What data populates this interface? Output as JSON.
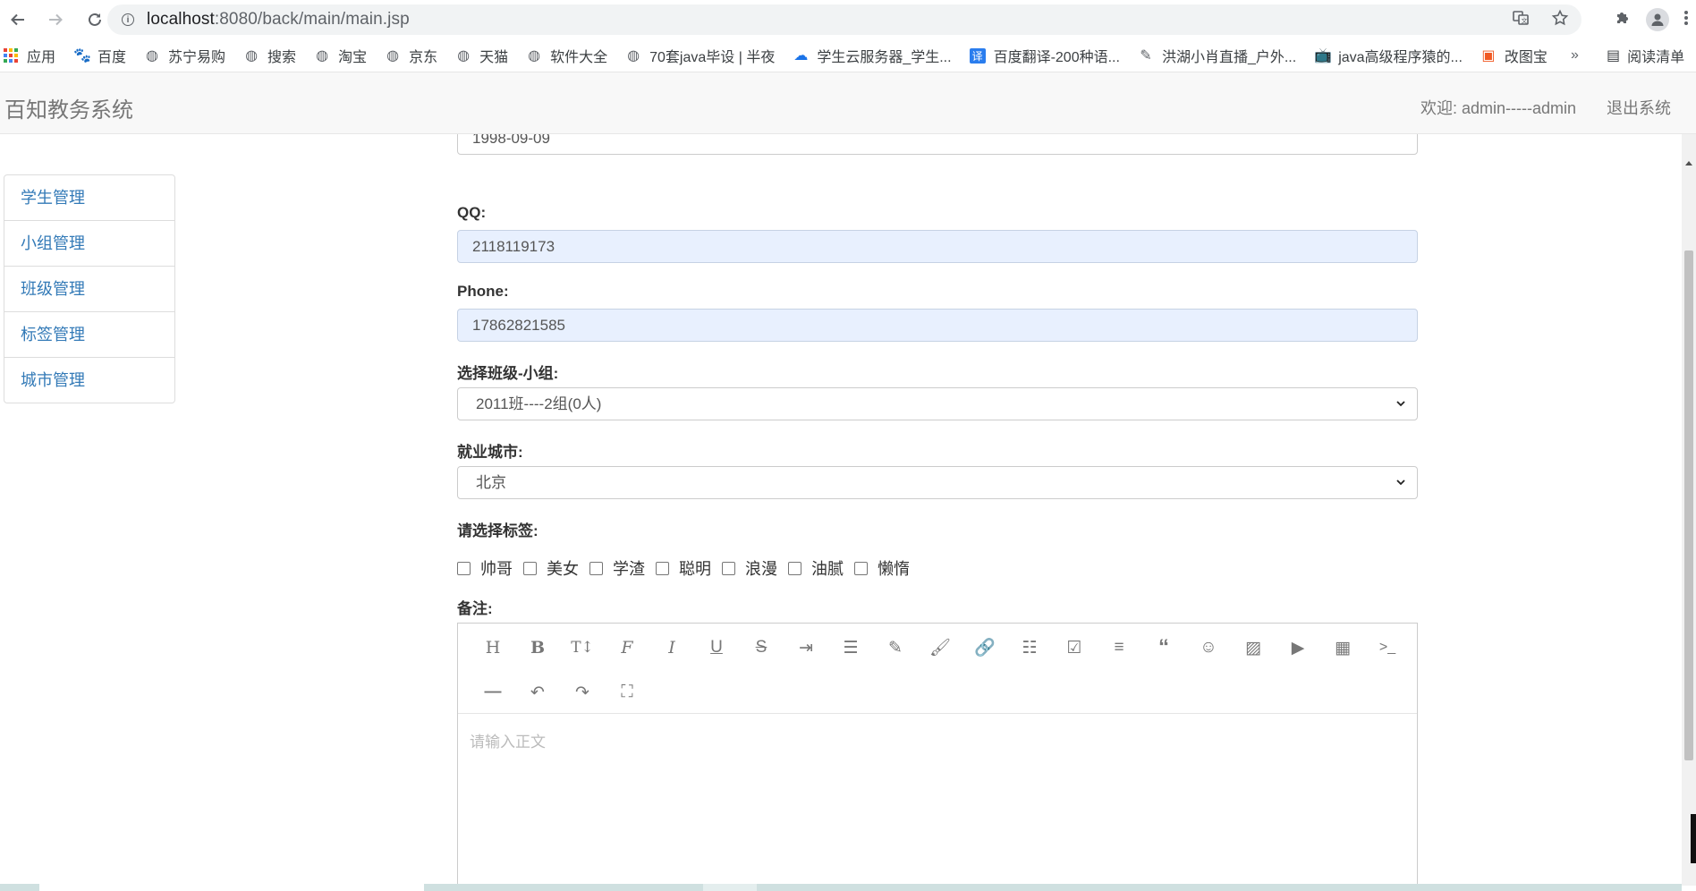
{
  "browser": {
    "url_host": "localhost",
    "url_rest": ":8080/back/main/main.jsp",
    "bookmarks": [
      {
        "label": "应用",
        "icon": "apps-grid-icon"
      },
      {
        "label": "百度",
        "icon": "baidu-paw-icon"
      },
      {
        "label": "苏宁易购",
        "icon": "globe-icon"
      },
      {
        "label": "搜索",
        "icon": "globe-icon"
      },
      {
        "label": "淘宝",
        "icon": "globe-icon"
      },
      {
        "label": "京东",
        "icon": "globe-icon"
      },
      {
        "label": "天猫",
        "icon": "globe-icon"
      },
      {
        "label": "软件大全",
        "icon": "globe-icon"
      },
      {
        "label": "70套java毕设 | 半夜",
        "icon": "globe-icon"
      },
      {
        "label": "学生云服务器_学生...",
        "icon": "cloud-icon"
      },
      {
        "label": "百度翻译-200种语...",
        "icon": "translate-icon"
      },
      {
        "label": "洪湖小肖直播_户外...",
        "icon": "feather-icon"
      },
      {
        "label": "java高级程序猿的...",
        "icon": "bilibili-icon"
      },
      {
        "label": "改图宝",
        "icon": "image-edit-icon"
      }
    ],
    "more_label": "»",
    "reading_list_label": "阅读清单"
  },
  "app": {
    "brand": "百知教务系统",
    "welcome": "欢迎: admin-----admin",
    "logout": "退出系统"
  },
  "sidebar": {
    "items": [
      {
        "label": "学生管理"
      },
      {
        "label": "小组管理"
      },
      {
        "label": "班级管理"
      },
      {
        "label": "标签管理"
      },
      {
        "label": "城市管理"
      }
    ]
  },
  "form": {
    "birthday_value": "1998-09-09",
    "qq_label": "QQ:",
    "qq_value": "2118119173",
    "phone_label": "Phone:",
    "phone_value": "17862821585",
    "group_label": "选择班级-小组:",
    "group_value": "2011班----2组(0人)",
    "city_label": "就业城市:",
    "city_value": "北京",
    "tags_label": "请选择标签:",
    "tags": [
      {
        "label": "帅哥",
        "checked": false
      },
      {
        "label": "美女",
        "checked": false
      },
      {
        "label": "学渣",
        "checked": false
      },
      {
        "label": "聪明",
        "checked": false
      },
      {
        "label": "浪漫",
        "checked": false
      },
      {
        "label": "油腻",
        "checked": false
      },
      {
        "label": "懒惰",
        "checked": false
      }
    ],
    "notes_label": "备注:",
    "editor_placeholder": "请输入正文"
  },
  "editor_toolbar": {
    "row1": [
      "heading-icon",
      "bold-icon",
      "font-size-icon",
      "font-family-icon",
      "italic-icon",
      "underline-icon",
      "strikethrough-icon",
      "indent-icon",
      "line-height-icon",
      "pencil-icon",
      "brush-icon",
      "link-icon",
      "bullet-list-icon",
      "todo-checkbox-icon",
      "align-icon",
      "quote-icon",
      "emoji-icon",
      "image-icon",
      "video-icon",
      "table-icon",
      "code-icon"
    ],
    "row2": [
      "divider-icon",
      "undo-icon",
      "redo-icon",
      "fullscreen-icon"
    ]
  }
}
